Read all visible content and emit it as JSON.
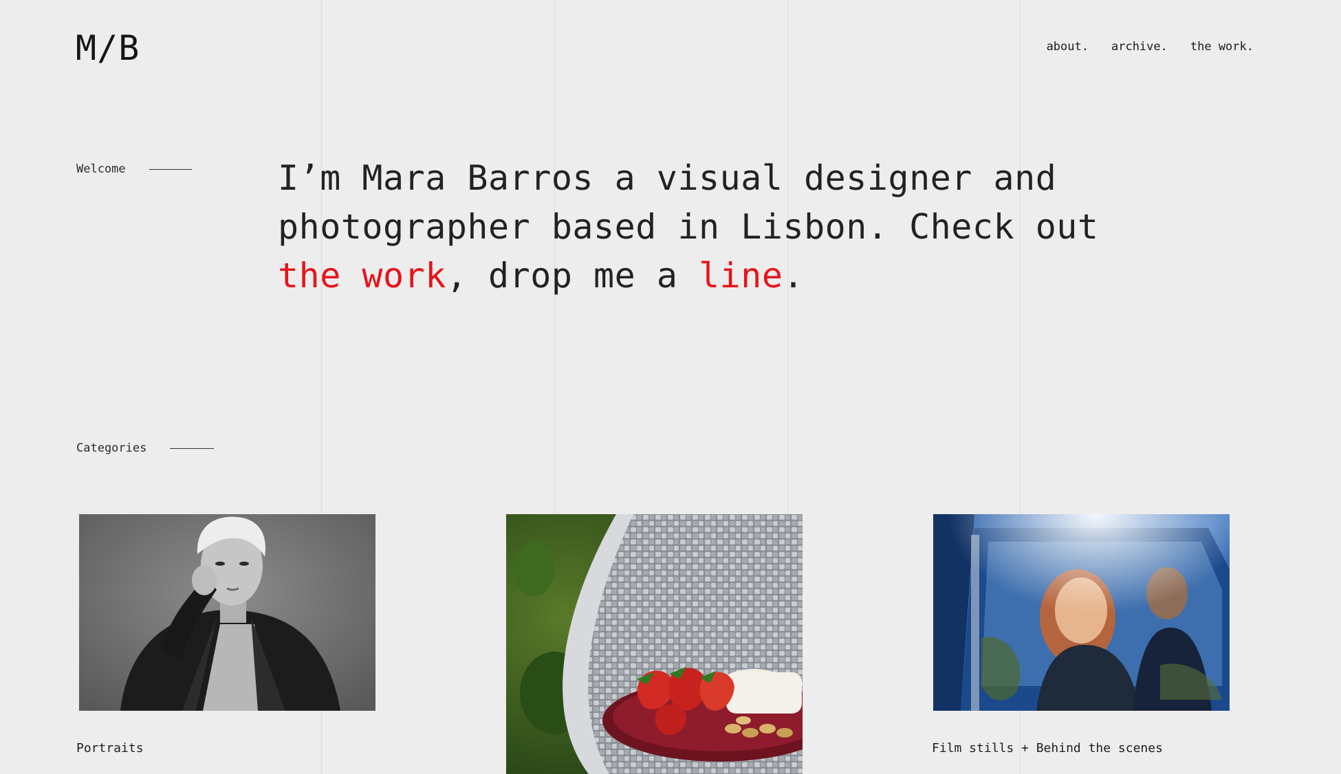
{
  "header": {
    "logo": "M/B",
    "nav": [
      "about.",
      "archive.",
      "the work."
    ]
  },
  "welcome": {
    "label": "Welcome",
    "intro_part1": "I’m Mara Barros a visual designer and photographer based in Lisbon. Check out ",
    "link_work": "the work",
    "intro_part2": ", drop me a ",
    "link_line": "line",
    "intro_end": "."
  },
  "categories": {
    "label": "Categories",
    "items": [
      {
        "caption": "Portraits",
        "image": "black-and-white portrait of a woman in a leather jacket"
      },
      {
        "caption": "",
        "image": "plate of strawberries and cheese on a woven wicker chair"
      },
      {
        "caption": "Film stills + Behind the scenes",
        "image": "woman and man seen through a blue car window"
      }
    ]
  },
  "colors": {
    "background": "#ededed",
    "accent": "#e8131b",
    "text": "#1a1a1a"
  }
}
